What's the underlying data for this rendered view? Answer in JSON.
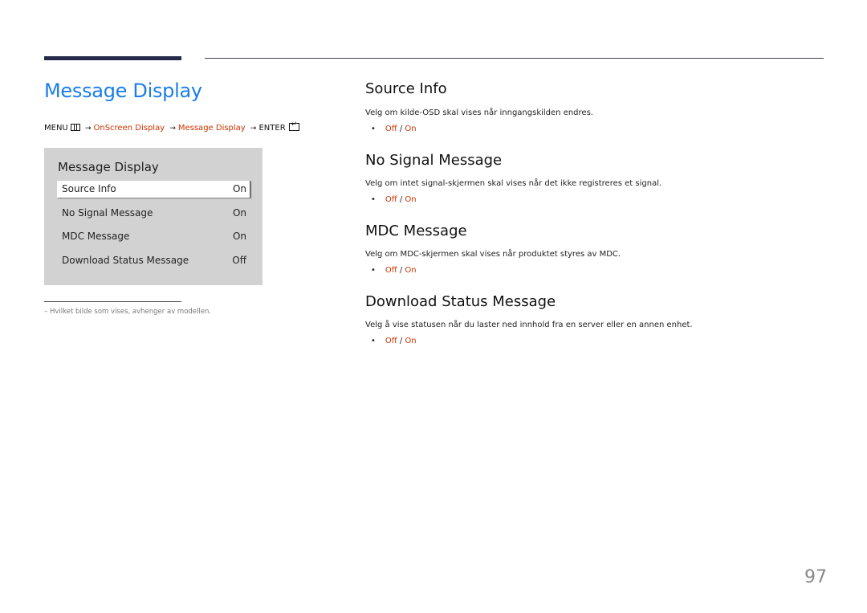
{
  "page": {
    "title": "Message Display",
    "page_number": "97"
  },
  "breadcrumb": {
    "menu": "MENU",
    "arrow": "→",
    "item1": "OnScreen Display",
    "item2": "Message Display",
    "enter": "ENTER"
  },
  "osd": {
    "title": "Message Display",
    "rows": [
      {
        "label": "Source Info",
        "value": "On",
        "selected": true
      },
      {
        "label": "No Signal Message",
        "value": "On",
        "selected": false
      },
      {
        "label": "MDC Message",
        "value": "On",
        "selected": false
      },
      {
        "label": "Download Status Message",
        "value": "Off",
        "selected": false
      }
    ]
  },
  "footnote": "–  Hvilket bilde som vises, avhenger av modellen.",
  "sections": [
    {
      "heading": "Source Info",
      "desc": "Velg om kilde-OSD skal vises når inngangskilden endres.",
      "opt_off": "Off",
      "sep": " / ",
      "opt_on": "On"
    },
    {
      "heading": "No Signal Message",
      "desc": "Velg om intet signal-skjermen skal vises når det ikke registreres et signal.",
      "opt_off": "Off",
      "sep": " / ",
      "opt_on": "On"
    },
    {
      "heading": "MDC Message",
      "desc": "Velg om MDC-skjermen skal vises når produktet styres av MDC.",
      "opt_off": "Off",
      "sep": " / ",
      "opt_on": "On"
    },
    {
      "heading": "Download Status Message",
      "desc": "Velg å vise statusen når du laster ned innhold fra en server eller en annen enhet.",
      "opt_off": "Off",
      "sep": " / ",
      "opt_on": "On"
    }
  ],
  "bullet": "•",
  "colors": {
    "title": "#1a7de8",
    "accent_red": "#cc3300",
    "osd_bg": "#d2d2d2"
  }
}
